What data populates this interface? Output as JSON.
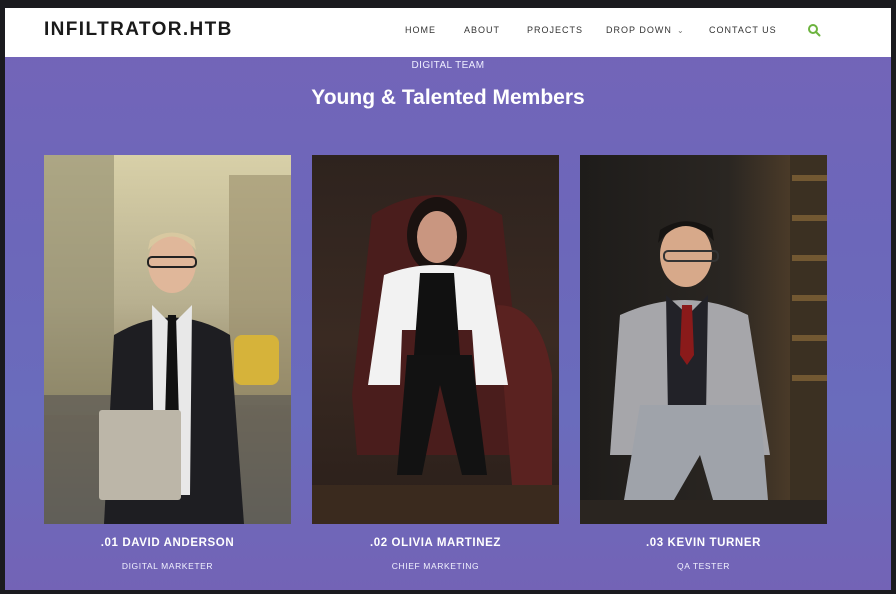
{
  "header": {
    "brand": "INFILTRATOR.HTB",
    "nav": {
      "home": "HOME",
      "about": "ABOUT",
      "projects": "PROJECTS",
      "dropdown": "DROP DOWN",
      "contact": "CONTACT US"
    },
    "dropdown_icon": "chevron-down-icon",
    "search_icon": "search-icon"
  },
  "team": {
    "subtitle": "DIGITAL TEAM",
    "title": "Young & Talented Members",
    "members": [
      {
        "name": ".01 DAVID ANDERSON",
        "role": "DIGITAL MARKETER"
      },
      {
        "name": ".02 OLIVIA MARTINEZ",
        "role": "CHIEF MARKETING"
      },
      {
        "name": ".03 KEVIN TURNER",
        "role": "QA TESTER"
      }
    ]
  },
  "colors": {
    "accent": "#6cb33e",
    "section_bg": "#6c67ba"
  }
}
